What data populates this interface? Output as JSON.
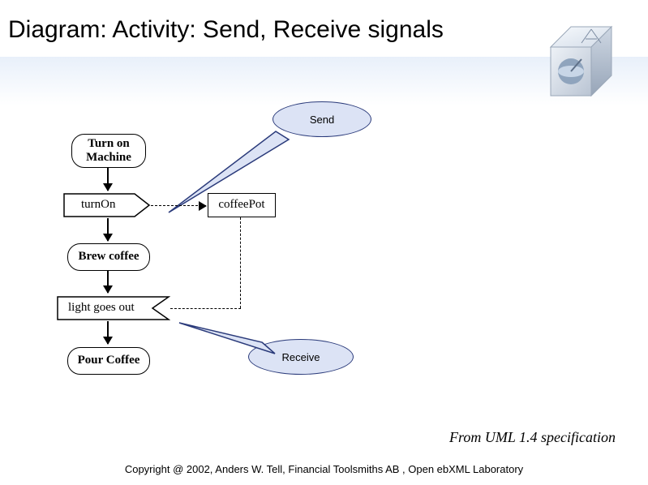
{
  "title": "Diagram: Activity: Send, Receive signals",
  "callouts": {
    "send": "Send",
    "receive": "Receive"
  },
  "nodes": {
    "start_label_line1": "Turn on",
    "start_label_line2": "Machine",
    "send_signal": "turnOn",
    "object": "coffeePot",
    "brew": "Brew coffee",
    "receive_signal": "light goes out",
    "pour": "Pour Coffee"
  },
  "source": "From UML 1.4 specification",
  "copyright": "Copyright @ 2002, Anders W. Tell, Financial Toolsmiths AB , Open ebXML Laboratory"
}
